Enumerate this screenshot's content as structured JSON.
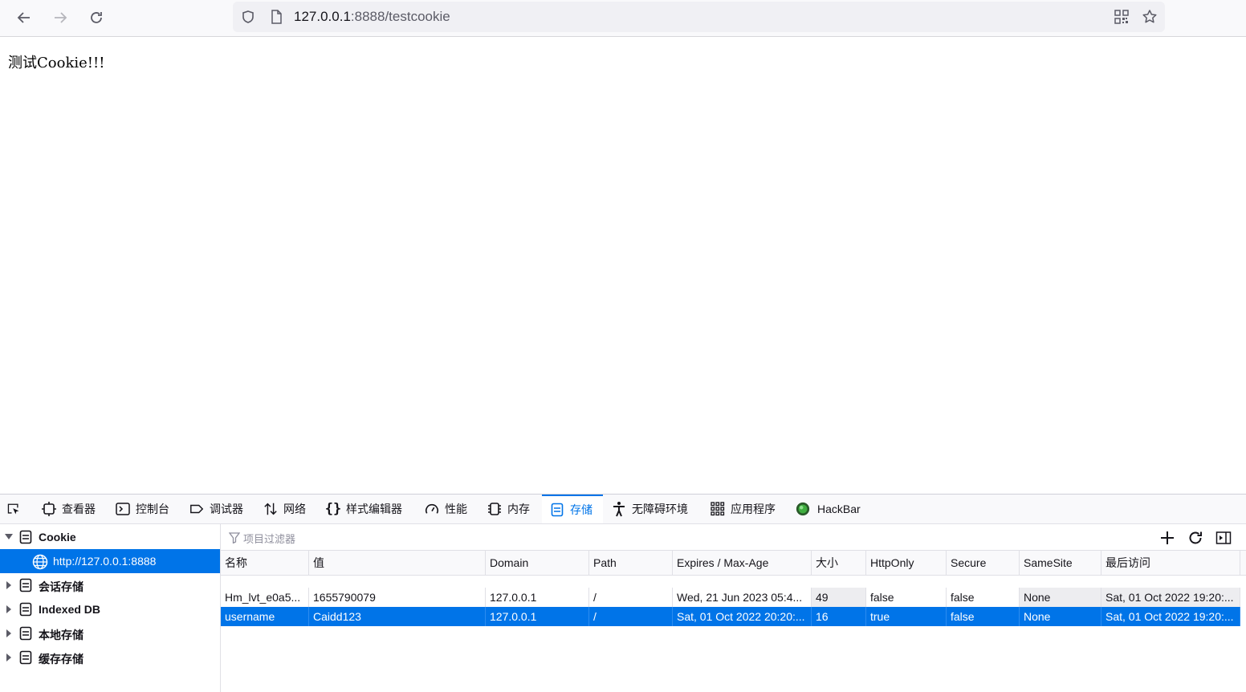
{
  "browser": {
    "url_host": "127.0.0.1",
    "url_path": ":8888/testcookie",
    "icons": [
      "back-icon",
      "forward-icon",
      "reload-icon",
      "shield-icon",
      "page-icon",
      "qr-code-icon",
      "bookmark-star-icon"
    ]
  },
  "page": {
    "text": "测试Cookie!!!"
  },
  "devtools": {
    "tabs": [
      {
        "label": ""
      },
      {
        "label": "查看器"
      },
      {
        "label": "控制台"
      },
      {
        "label": "调试器"
      },
      {
        "label": "网络"
      },
      {
        "label": "样式编辑器"
      },
      {
        "label": "性能"
      },
      {
        "label": "内存"
      },
      {
        "label": "存储"
      },
      {
        "label": "无障碍环境"
      },
      {
        "label": "应用程序"
      },
      {
        "label": "HackBar"
      }
    ],
    "active_tab": "存储",
    "accent": "#0074e8",
    "tree": [
      {
        "label": "Cookie"
      },
      {
        "label": "http://127.0.0.1:8888"
      },
      {
        "label": "会话存储"
      },
      {
        "label": "Indexed DB"
      },
      {
        "label": "本地存储"
      },
      {
        "label": "缓存存储"
      }
    ],
    "filter_placeholder": "项目过滤器",
    "columns": [
      "名称",
      "值",
      "Domain",
      "Path",
      "Expires / Max-Age",
      "大小",
      "HttpOnly",
      "Secure",
      "SameSite",
      "最后访问"
    ],
    "rows": [
      [
        "Hm_lvt_e0a5...",
        "1655790079",
        "127.0.0.1",
        "/",
        "Wed, 21 Jun 2023 05:4...",
        "49",
        "false",
        "false",
        "None",
        "Sat, 01 Oct 2022 19:20:..."
      ],
      [
        "username",
        "Caidd123",
        "127.0.0.1",
        "/",
        "Sat, 01 Oct 2022 20:20:...",
        "16",
        "true",
        "false",
        "None",
        "Sat, 01 Oct 2022 19:20:..."
      ]
    ]
  }
}
